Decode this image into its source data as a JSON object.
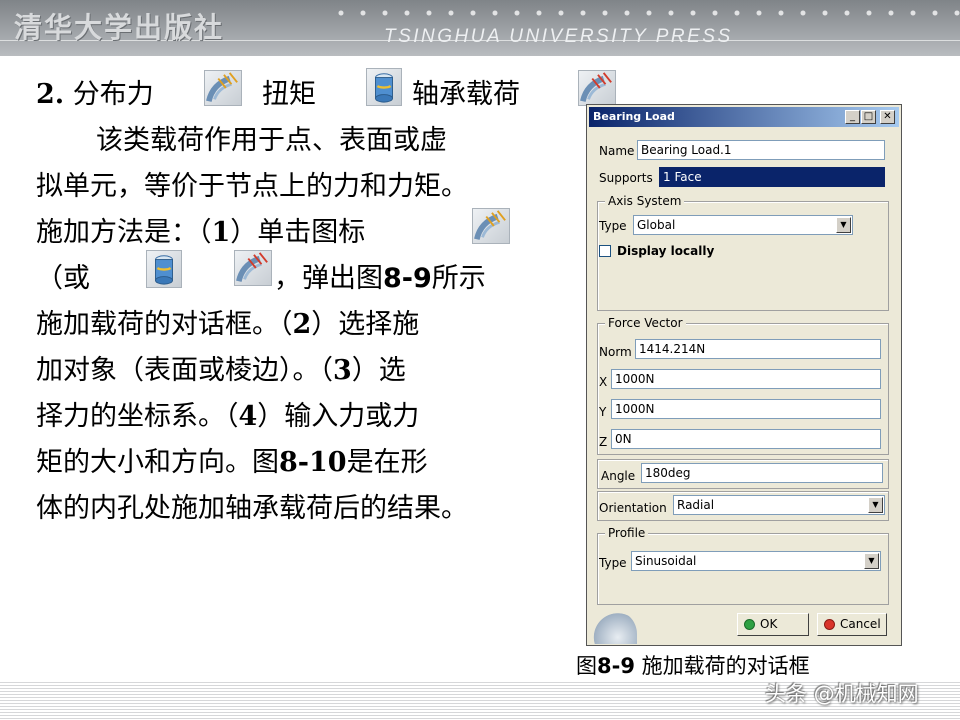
{
  "header": {
    "brand_cn": "清华大学出版社",
    "brand_en": "TSINGHUA UNIVERSITY PRESS"
  },
  "text": {
    "line1_a": "2.",
    "line1_b": " 分布力",
    "line1_c": "扭矩",
    "line1_d": "轴承载荷",
    "line2": "该类载荷作用于点、表面或虚",
    "line3": "拟单元，等价于节点上的力和力矩。",
    "line4_a": "施加方法是：（",
    "line4_b": "1",
    "line4_c": "）单击图标",
    "line5_a": "（或",
    "line5_b": "，",
    "line5_c": "弹出图",
    "line5_d": "8-9",
    "line5_e": "所示",
    "line6_a": "施加载荷的对话框。（",
    "line6_b": "2",
    "line6_c": "）选择施",
    "line7_a": "加对象（表面或棱边）。（",
    "line7_b": "3",
    "line7_c": "）选",
    "line8_a": "择力的坐标系。（",
    "line8_b": "4",
    "line8_c": "）输入力或力",
    "line9_a": "矩的大小和方向。图",
    "line9_b": "8-10",
    "line9_c": "是在形",
    "line10": "体的内孔处施加轴承载荷后的结果。"
  },
  "icons": {
    "distributed_force": "distributed-force-icon",
    "moment": "moment-icon",
    "bearing_load": "bearing-load-icon"
  },
  "dialog": {
    "title": "Bearing Load",
    "name_label": "Name",
    "name_value": "Bearing Load.1",
    "supports_label": "Supports",
    "supports_value": "1 Face",
    "axis_system_caption": "Axis System",
    "type_label": "Type",
    "axis_type_value": "Global",
    "display_locally_label": "Display locally",
    "force_vector_caption": "Force Vector",
    "norm_label": "Norm",
    "norm_value": "1414.214N",
    "x_label": "X",
    "x_value": "1000N",
    "y_label": "Y",
    "y_value": "1000N",
    "z_label": "Z",
    "z_value": "0N",
    "angle_label": "Angle",
    "angle_value": "180deg",
    "orientation_label": "Orientation",
    "orientation_value": "Radial",
    "profile_caption": "Profile",
    "profile_type_value": "Sinusoidal",
    "ok_label": "OK",
    "cancel_label": "Cancel"
  },
  "caption": {
    "prefix": "图",
    "number": "8-9",
    "text": " 施加载荷的对话框"
  },
  "watermark": "头条 @机械知网",
  "colors": {
    "titlebar_start": "#0a246a",
    "titlebar_end": "#a6caf0",
    "dialog_bg": "#ece9d8",
    "ok_dot": "#2ea043",
    "cancel_dot": "#d9342b"
  }
}
